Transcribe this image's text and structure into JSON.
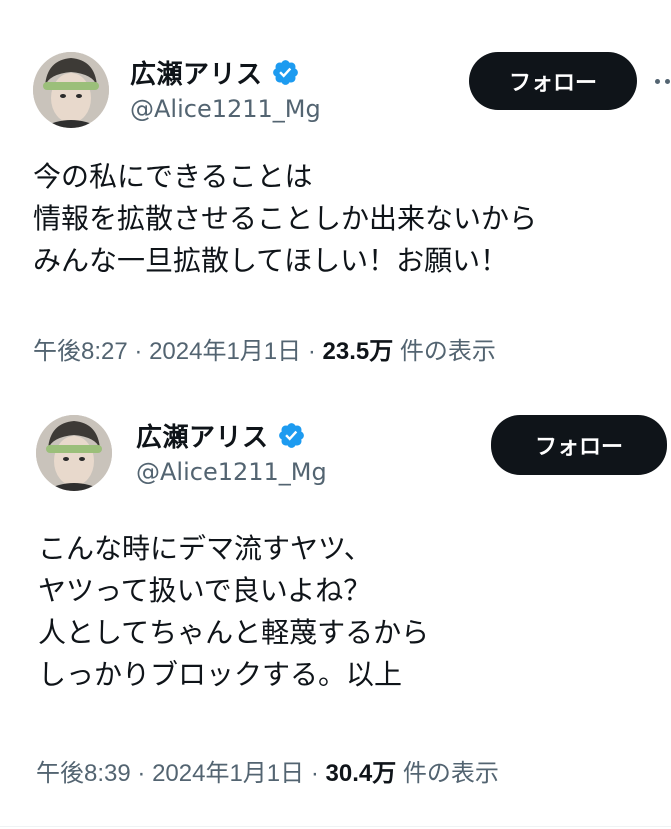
{
  "tweets": [
    {
      "author_name": "広瀬アリス",
      "handle": "@Alice1211_Mg",
      "follow_label": "フォロー",
      "verified": true,
      "body_lines": [
        "今の私にできることは",
        "情報を拡散させることしか出来ないから",
        "みんな一旦拡散してほしい！お願い！"
      ],
      "time": "午後8:27",
      "date": "2024年1月1日",
      "views": "23.5万",
      "views_suffix": "件の表示"
    },
    {
      "author_name": "広瀬アリス",
      "handle": "@Alice1211_Mg",
      "follow_label": "フォロー",
      "verified": true,
      "body_lines": [
        "こんな時にデマ流すヤツ、",
        "ヤツって扱いで良いよね？",
        "人としてちゃんと軽蔑するから",
        "しっかりブロックする。以上"
      ],
      "time": "午後8:39",
      "date": "2024年1月1日",
      "views": "30.4万",
      "views_suffix": "件の表示"
    }
  ],
  "separator": "·",
  "colors": {
    "text_primary": "#0f1419",
    "text_secondary": "#536471",
    "verified_blue": "#1d9bf0",
    "follow_button_bg": "#0f1419",
    "follow_button_text": "#ffffff"
  },
  "icons": [
    "verified-badge-icon",
    "more-options-icon"
  ]
}
